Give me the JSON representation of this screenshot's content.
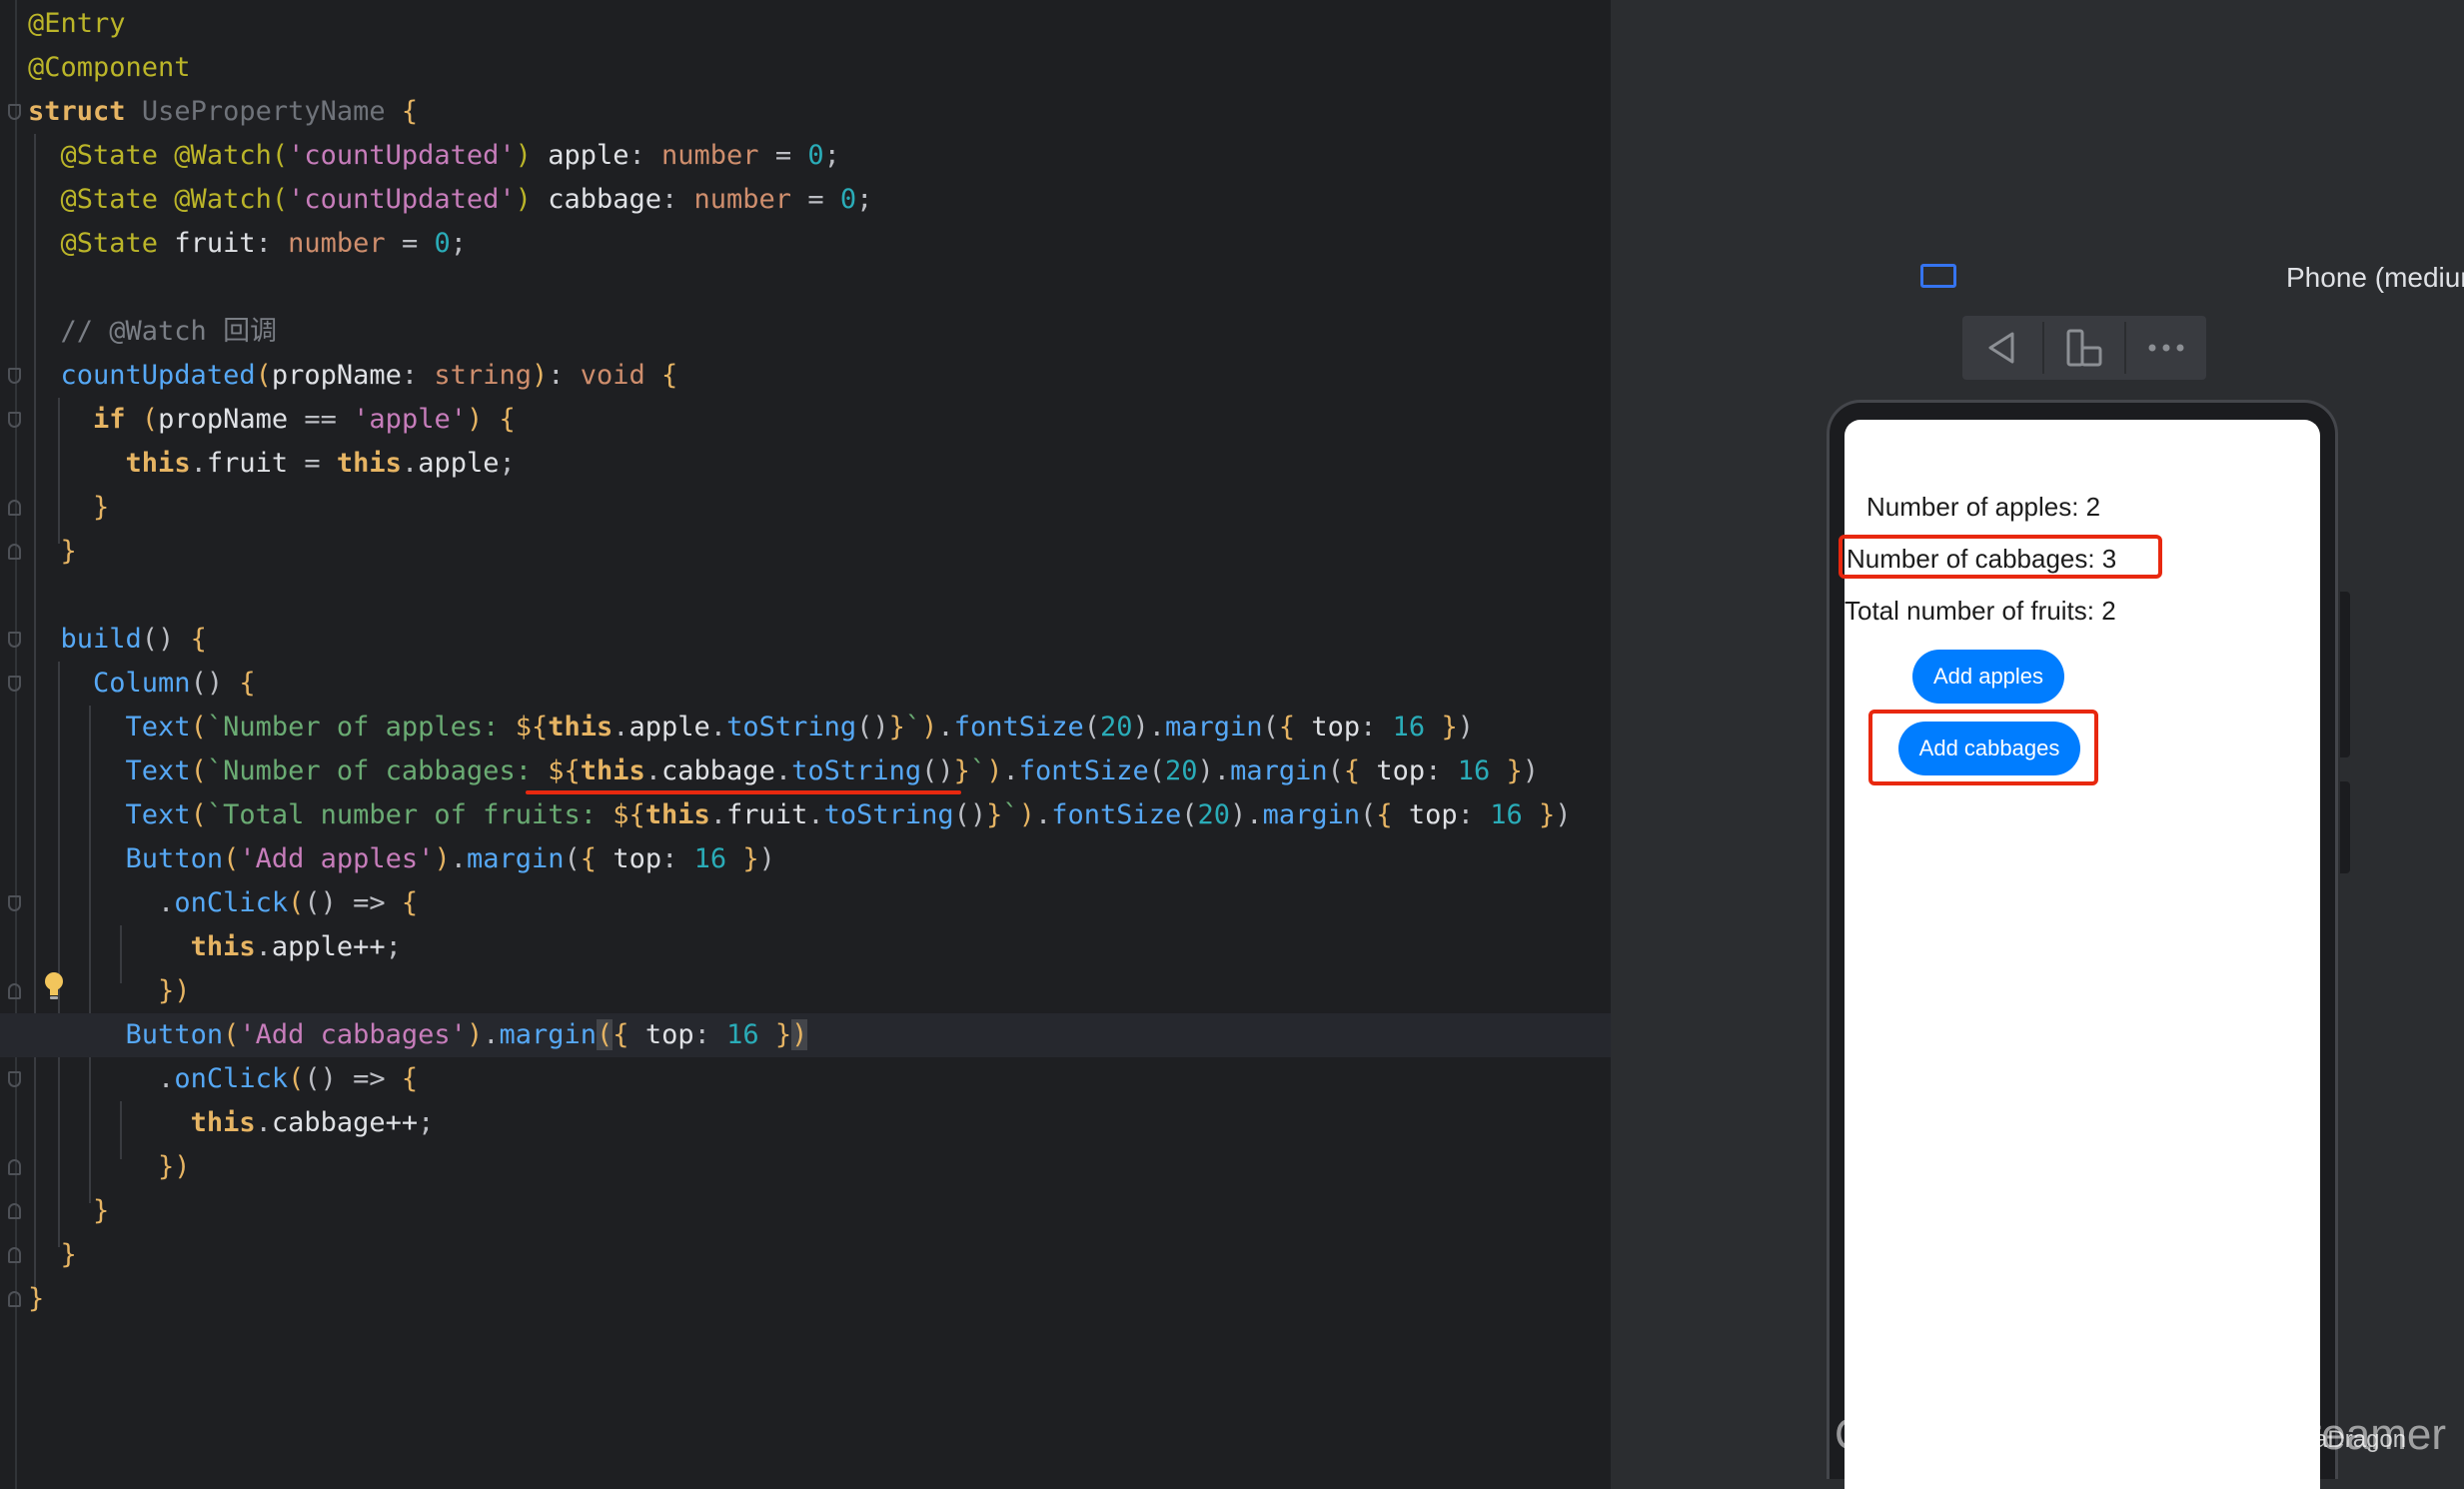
{
  "editor": {
    "lines": {
      "l1": "@Entry",
      "l2": "@Component",
      "l3_kw": "struct",
      "l3_name": "UsePropertyName",
      "l4": {
        "ann": "@State @Watch(",
        "str": "'countUpdated'",
        "close": ")",
        "prop": "apple",
        "colon": ":",
        "type": "number",
        "eq": "=",
        "num": "0",
        "semi": ";"
      },
      "l5": {
        "ann": "@State @Watch(",
        "str": "'countUpdated'",
        "close": ")",
        "prop": "cabbage",
        "colon": ":",
        "type": "number",
        "eq": "=",
        "num": "0",
        "semi": ";"
      },
      "l6": {
        "ann": "@State",
        "prop": "fruit",
        "colon": ":",
        "type": "number",
        "eq": "=",
        "num": "0",
        "semi": ";"
      },
      "l8": "// @Watch 回调",
      "l9": {
        "fn": "countUpdated",
        "param": "propName",
        "type": "string",
        "ret": "void"
      },
      "l10": {
        "kw": "if",
        "param": "propName",
        "op": "==",
        "str": "'apple'"
      },
      "l11": {
        "this1": "this",
        "prop1": "fruit",
        "this2": "this",
        "prop2": "apple"
      },
      "l14": "build",
      "l15": "Column",
      "text_fn": "Text",
      "font_fn": "fontSize",
      "margin_fn": "margin",
      "tostring_fn": "toString",
      "top_key": "top",
      "l16": {
        "tpl": "`Number of apples: ",
        "prop": "apple",
        "size": "20",
        "top": "16"
      },
      "l17": {
        "tpl": "`Number of cabbages: ",
        "prop": "cabbage",
        "size": "20",
        "top": "16"
      },
      "l18": {
        "tpl": "`Total number of fruits: ",
        "prop": "fruit",
        "size": "20",
        "top": "16"
      },
      "button_fn": "Button",
      "onclick_fn": "onClick",
      "l19": {
        "str": "'Add apples'",
        "top": "16"
      },
      "l21": {
        "this": "this",
        "stmt": "apple++"
      },
      "l23": {
        "str": "'Add cabbages'",
        "top": "16"
      },
      "l25": {
        "this": "this",
        "stmt": "cabbage++"
      }
    }
  },
  "previewer": {
    "device_name": "Phone (medium)",
    "toolbar": [
      "back-icon",
      "rotate-device-icon",
      "more-icon"
    ],
    "app": {
      "apples_text": "Number of apples: 2",
      "cabbages_text": "Number of cabbages: 3",
      "fruits_text": "Total number of fruits: 2",
      "add_apples": "Add apples",
      "add_cabbages": "Add cabbages"
    },
    "highlight_color": "#e8280f",
    "accent": "#007dff"
  },
  "watermark": {
    "csdn": "CSDN @ChinaDragonDreamer",
    "juejin": "掘金技术社区 @ ChinaDragon"
  }
}
